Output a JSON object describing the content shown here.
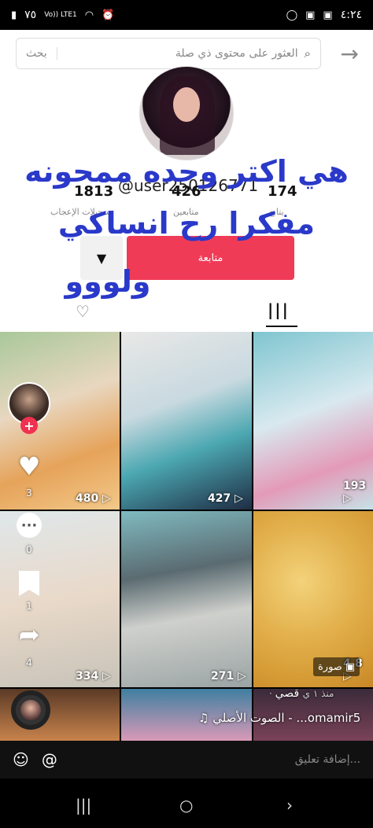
{
  "status_bar": {
    "time": "٤:٢٤",
    "battery": "٧٥",
    "network": "Vo)) LTE1"
  },
  "search": {
    "button_label": "بحث",
    "query": "العثور على محتوى ذي صلة"
  },
  "profile": {
    "username": "@user250126771",
    "stats": [
      {
        "value": "1813",
        "label": "تسجيلات الإعجاب"
      },
      {
        "value": "426",
        "label": "متابعين"
      },
      {
        "value": "174",
        "label": "يتابع"
      }
    ],
    "follow_label": "متابعة",
    "dropdown_icon": "▼"
  },
  "overlay": {
    "line1": "هي اكتر وحده ممحونه",
    "line2": "مفكرا رح انساكي",
    "line3": "ولووو"
  },
  "tabs": {
    "grid_icon": "|||",
    "liked_icon": "♡"
  },
  "grid": {
    "views": [
      "480",
      "427",
      "193",
      "334",
      "271",
      "4.8"
    ]
  },
  "rail": {
    "likes": "3",
    "comments": "0",
    "bookmarks": "1",
    "shares": "4"
  },
  "photo_tag": "صورة",
  "caption": {
    "author": "قصي",
    "time": "· منذ ١ ي",
    "sound": "♫ الصوت الأصلي - ...omamir5"
  },
  "comment_bar": {
    "placeholder": "إضافة تعليق...",
    "emoji_icon": "☺",
    "at_icon": "@"
  },
  "nav": {
    "recents_icon": "|||",
    "home_icon": "○",
    "back_icon": "›"
  }
}
